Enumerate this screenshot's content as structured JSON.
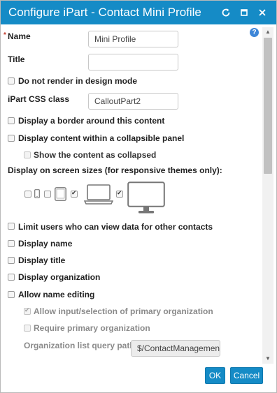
{
  "dialog": {
    "title": "Configure iPart - Contact Mini Profile",
    "required_marker": "*",
    "help_label": "?"
  },
  "form": {
    "name": {
      "label": "Name",
      "value": "Mini Profile"
    },
    "title": {
      "label": "Title",
      "value": ""
    },
    "do_not_render": {
      "label": "Do not render in design mode",
      "checked": false
    },
    "css_class": {
      "label": "iPart CSS class",
      "value": "CalloutPart2"
    },
    "display_border": {
      "label": "Display a border around this content",
      "checked": false
    },
    "collapsible_panel": {
      "label": "Display content within a collapsible panel",
      "checked": false
    },
    "show_collapsed": {
      "label": "Show the content as collapsed",
      "checked": false,
      "disabled": true
    },
    "screen_sizes": {
      "label": "Display on screen sizes (for responsive themes only):",
      "devices": [
        {
          "name": "phone-small",
          "checked": false
        },
        {
          "name": "phone",
          "checked": false
        },
        {
          "name": "tablet",
          "checked": true
        },
        {
          "name": "laptop",
          "checked": true
        },
        {
          "name": "desktop",
          "checked": null
        }
      ]
    },
    "limit_users": {
      "label": "Limit users who can view data for other contacts",
      "checked": false
    },
    "display_name": {
      "label": "Display name",
      "checked": false
    },
    "display_title": {
      "label": "Display title",
      "checked": false
    },
    "display_org": {
      "label": "Display organization",
      "checked": false
    },
    "allow_name_edit": {
      "label": "Allow name editing",
      "checked": false
    },
    "allow_primary_org": {
      "label": "Allow input/selection of primary organization",
      "checked": true,
      "disabled": true
    },
    "require_primary_org": {
      "label": "Require primary organization",
      "checked": false,
      "disabled": true
    },
    "org_query_path": {
      "label": "Organization list query path",
      "value": "$/ContactManagement"
    }
  },
  "buttons": {
    "ok": "OK",
    "cancel": "Cancel"
  },
  "colors": {
    "accent": "#158bc6",
    "help": "#3d86d8"
  }
}
